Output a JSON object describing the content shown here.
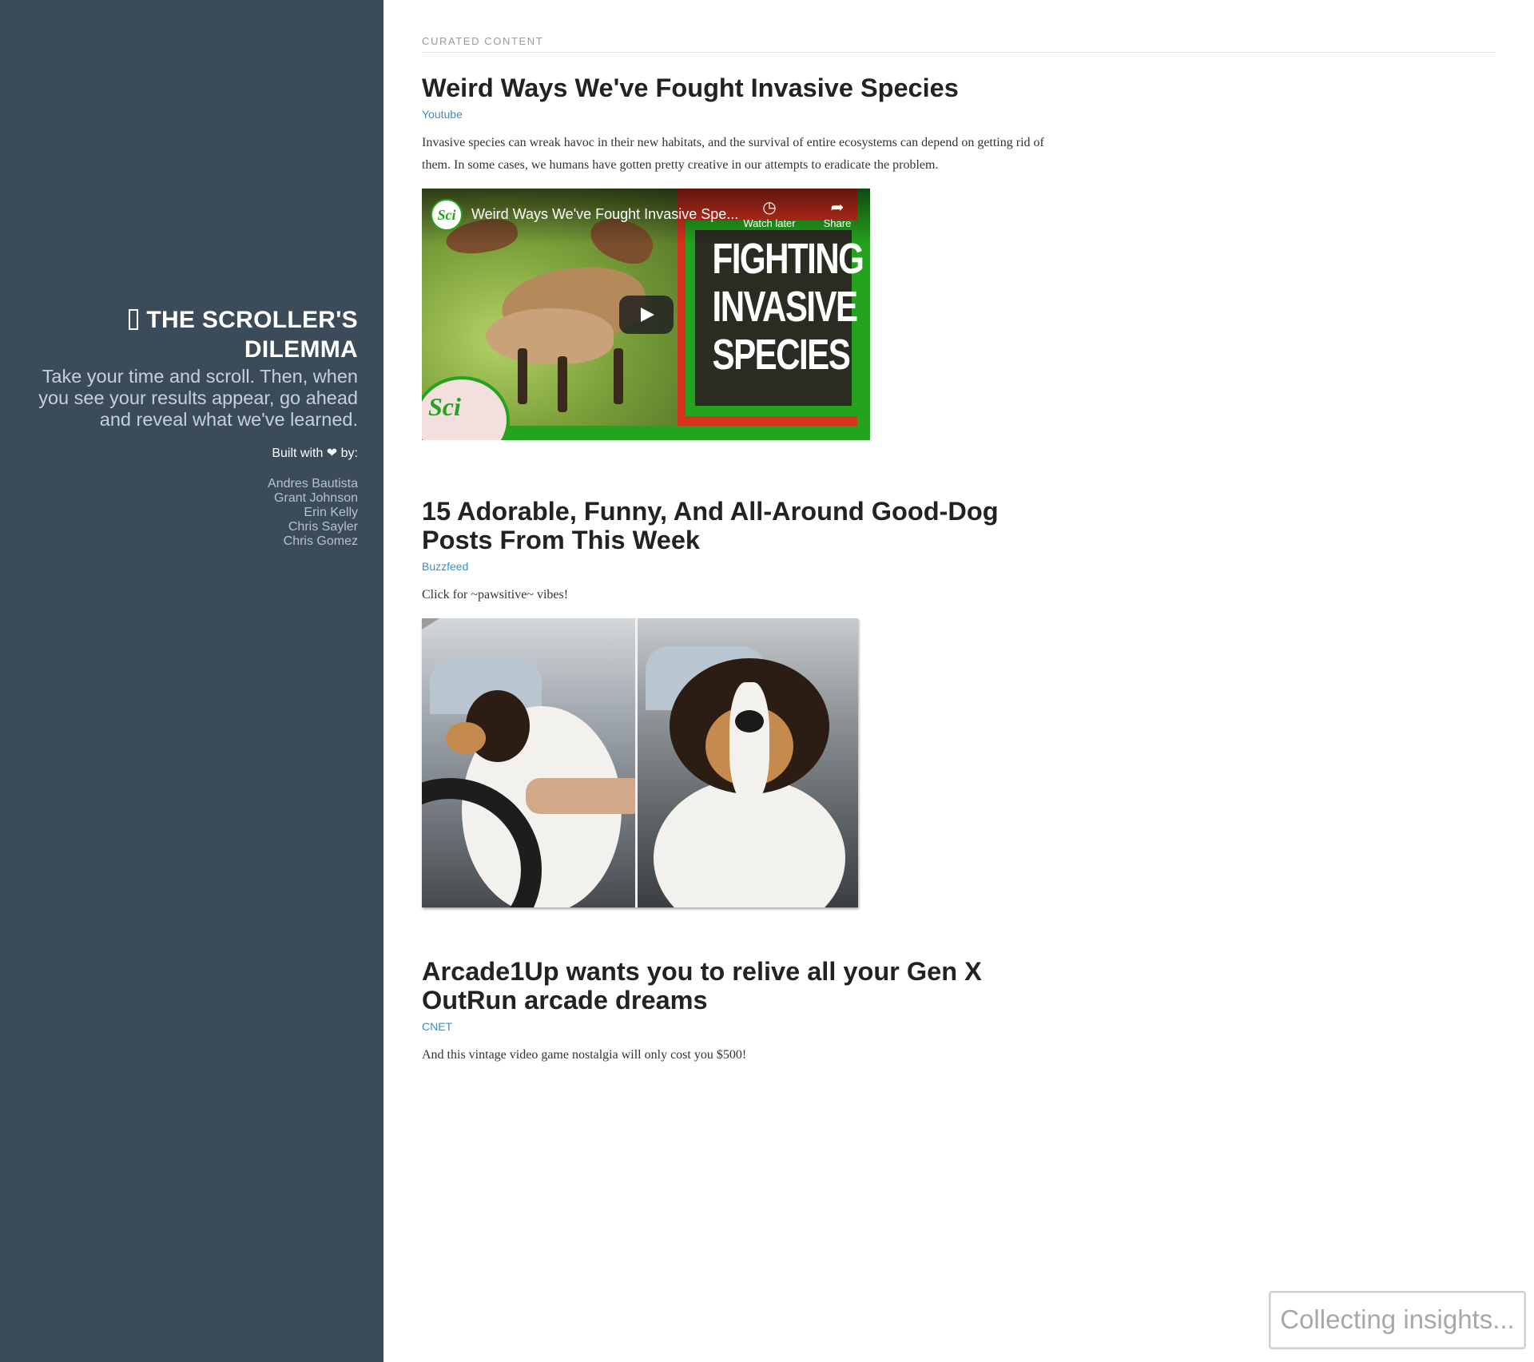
{
  "sidebar": {
    "title": "THE SCROLLER'S DILEMMA",
    "logo_icon": "app-logo-icon",
    "tagline": "Take your time and scroll. Then, when you see your results appear, go ahead and reveal what we've learned.",
    "built_with_prefix": "Built with",
    "heart": "❤",
    "built_with_suffix": "by:",
    "authors": [
      "Andres Bautista",
      "Grant Johnson",
      "Erin Kelly",
      "Chris Sayler",
      "Chris Gomez"
    ]
  },
  "main": {
    "section_label": "CURATED CONTENT",
    "articles": [
      {
        "title": "Weird Ways We've Fought Invasive Species",
        "source": "Youtube",
        "description": "Invasive species can wreak havoc in their new habitats, and the survival of entire ecosystems can depend on getting rid of them. In some cases, we humans have gotten pretty creative in our attempts to eradicate the problem.",
        "video": {
          "title": "Weird Ways We've Fought Invasive Spe...",
          "channel_badge": "Sci",
          "watch_later": "Watch later",
          "share": "Share",
          "thumbnail_text": [
            "FIGHTING",
            "INVASIVE",
            "SPECIES"
          ],
          "watermark": "Sci"
        }
      },
      {
        "title": "15 Adorable, Funny, And All-Around Good-Dog Posts From This Week",
        "source": "Buzzfeed",
        "description": "Click for ~pawsitive~ vibes!"
      },
      {
        "title": "Arcade1Up wants you to relive all your Gen X OutRun arcade dreams",
        "source": "CNET",
        "description": "And this vintage video game nostalgia will only cost you $500!"
      }
    ]
  },
  "insights_button": "Collecting insights...",
  "colors": {
    "sidebar_bg": "#3b4b59",
    "link": "#3a8ecb",
    "heading": "#222222"
  }
}
